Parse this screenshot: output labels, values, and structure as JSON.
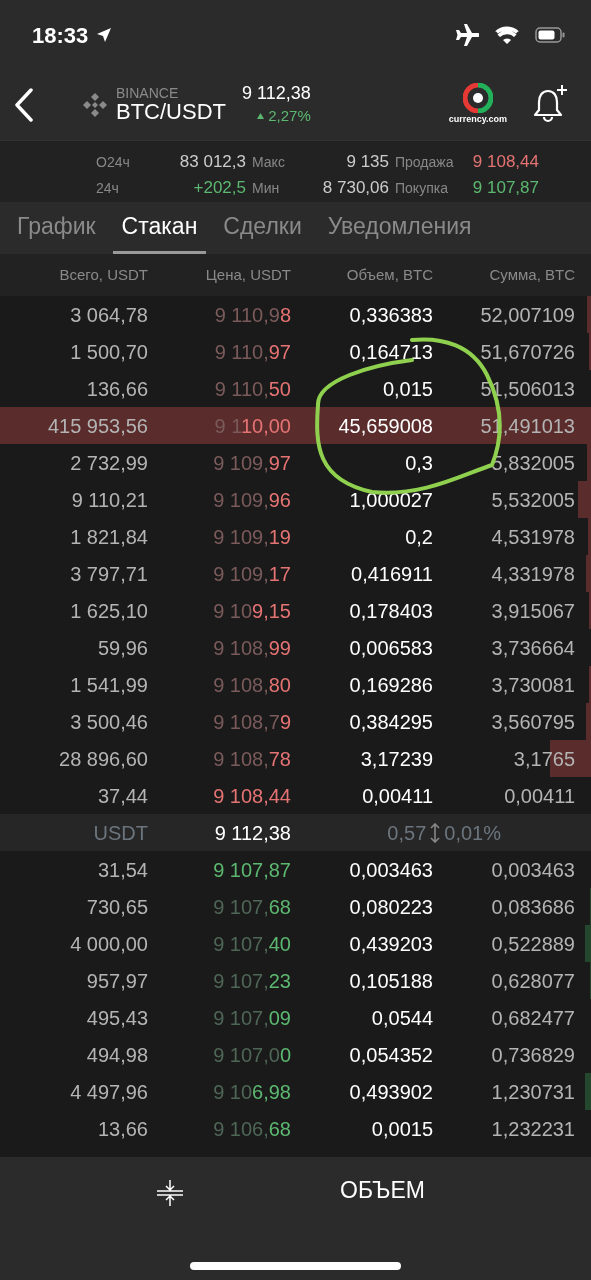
{
  "status_bar": {
    "time": "18:33"
  },
  "header": {
    "exchange": "BINANCE",
    "pair": "BTC/USDT",
    "price": "9 112,38",
    "change": "2,27%",
    "brand": "currency.com"
  },
  "stats": [
    {
      "label": "О24ч",
      "value": "83 012,3",
      "color": "#cccccc"
    },
    {
      "label": "Макс",
      "value": "9 135",
      "color": "#cccccc"
    },
    {
      "label": "Продажа",
      "value": "9 108,44",
      "color": "#e57373"
    },
    {
      "label": "24ч",
      "value": "+202,5",
      "color": "#5cb870"
    },
    {
      "label": "Мин",
      "value": "8 730,06",
      "color": "#cccccc"
    },
    {
      "label": "Покупка",
      "value": "9 107,87",
      "color": "#5cb870"
    }
  ],
  "tabs": [
    {
      "label": "График",
      "selected": false
    },
    {
      "label": "Стакан",
      "selected": true
    },
    {
      "label": "Сделки",
      "selected": false
    },
    {
      "label": "Уведомления",
      "selected": false
    }
  ],
  "columns": [
    "Всего, USDT",
    "Цена, USDT",
    "Объем, BTC",
    "Сумма, BTC"
  ],
  "asks": [
    {
      "total": "3 064,78",
      "price_same": "9 110,9",
      "price_new": "8",
      "volume": "0,336383",
      "sum": "52,007109"
    },
    {
      "total": "1 500,70",
      "price_same": "9 110,",
      "price_new": "97",
      "volume": "0,164713",
      "sum": "51,670726"
    },
    {
      "total": "136,66",
      "price_same": "9 110,",
      "price_new": "50",
      "volume": "0,015",
      "sum": "51,506013"
    },
    {
      "total": "415 953,56",
      "price_same": "9 1",
      "price_new": "10,00",
      "volume": "45,659008",
      "sum": "51,491013"
    },
    {
      "total": "2 732,99",
      "price_same": "9 109,",
      "price_new": "97",
      "volume": "0,3",
      "sum": "5,832005"
    },
    {
      "total": "9 110,21",
      "price_same": "9 109,",
      "price_new": "96",
      "volume": "1,000027",
      "sum": "5,532005"
    },
    {
      "total": "1 821,84",
      "price_same": "9 109,",
      "price_new": "19",
      "volume": "0,2",
      "sum": "4,531978"
    },
    {
      "total": "3 797,71",
      "price_same": "9 109,",
      "price_new": "17",
      "volume": "0,416911",
      "sum": "4,331978"
    },
    {
      "total": "1 625,10",
      "price_same": "9 10",
      "price_new": "9,15",
      "volume": "0,178403",
      "sum": "3,915067"
    },
    {
      "total": "59,96",
      "price_same": "9 108,",
      "price_new": "99",
      "volume": "0,006583",
      "sum": "3,736664"
    },
    {
      "total": "1 541,99",
      "price_same": "9 108,",
      "price_new": "80",
      "volume": "0,169286",
      "sum": "3,730081"
    },
    {
      "total": "3 500,46",
      "price_same": "9 108,7",
      "price_new": "9",
      "volume": "0,384295",
      "sum": "3,560795"
    },
    {
      "total": "28 896,60",
      "price_same": "9 108,",
      "price_new": "78",
      "volume": "3,17239",
      "sum": "3,1765"
    },
    {
      "total": "37,44",
      "price_new": "9 108,44",
      "volume": "0,00411",
      "sum": "0,00411"
    }
  ],
  "spread": {
    "currency": "USDT",
    "price": "9 112,38",
    "difference": "0,57",
    "percent": "0,01%"
  },
  "bids": [
    {
      "total": "31,54",
      "price_new": "9 107,87",
      "volume": "0,003463",
      "sum": "0,003463"
    },
    {
      "total": "730,65",
      "price_same": "9 107,",
      "price_new": "68",
      "volume": "0,080223",
      "sum": "0,083686"
    },
    {
      "total": "4 000,00",
      "price_same": "9 107,",
      "price_new": "40",
      "volume": "0,439203",
      "sum": "0,522889"
    },
    {
      "total": "957,97",
      "price_same": "9 107,",
      "price_new": "23",
      "volume": "0,105188",
      "sum": "0,628077"
    },
    {
      "total": "495,43",
      "price_same": "9 107,",
      "price_new": "09",
      "volume": "0,0544",
      "sum": "0,682477"
    },
    {
      "total": "494,98",
      "price_same": "9 107,0",
      "price_new": "0",
      "volume": "0,054352",
      "sum": "0,736829"
    },
    {
      "total": "4 497,96",
      "price_same": "9 10",
      "price_new": "6,98",
      "volume": "0,493902",
      "sum": "1,230731"
    },
    {
      "total": "13,66",
      "price_same": "9 106,",
      "price_new": "68",
      "volume": "0,0015",
      "sum": "1,232231"
    }
  ],
  "bottom_bar": {
    "mode": "ОБЪЕМ"
  }
}
